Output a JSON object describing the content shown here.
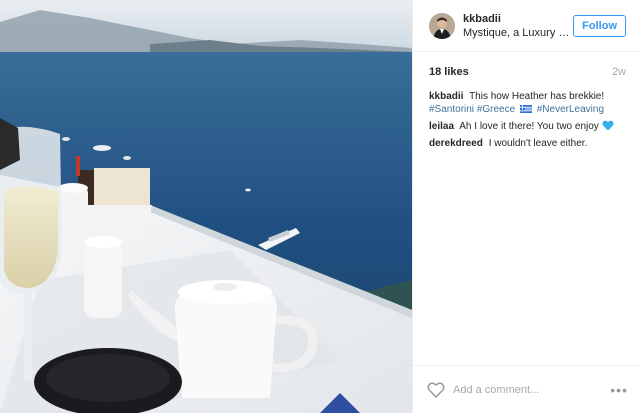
{
  "post": {
    "username": "kkbadii",
    "location": "Mystique, a Luxury C...",
    "follow_label": "Follow",
    "likes": "18 likes",
    "age": "2w",
    "caption": {
      "username": "kkbadii",
      "text": "This how Heather has brekkie!",
      "tags": [
        "#Santorini",
        "#Greece",
        "#NeverLeaving"
      ]
    },
    "comments": [
      {
        "username": "leilaa",
        "text": "Ah I love it there! You two enjoy"
      },
      {
        "username": "derekdreed",
        "text": "I wouldn't leave either."
      }
    ],
    "comment_placeholder": "Add a comment...",
    "more_label": "•••"
  },
  "icons": {
    "heart": "heart-icon",
    "flag": "greek-flag-icon",
    "blue_heart": "blue-heart-icon",
    "more": "more-options-icon"
  },
  "colors": {
    "link_blue": "#3897f0",
    "hashtag": "#3f729b",
    "sea": "#1f4f80",
    "blue_heart": "#3ab0e8"
  }
}
